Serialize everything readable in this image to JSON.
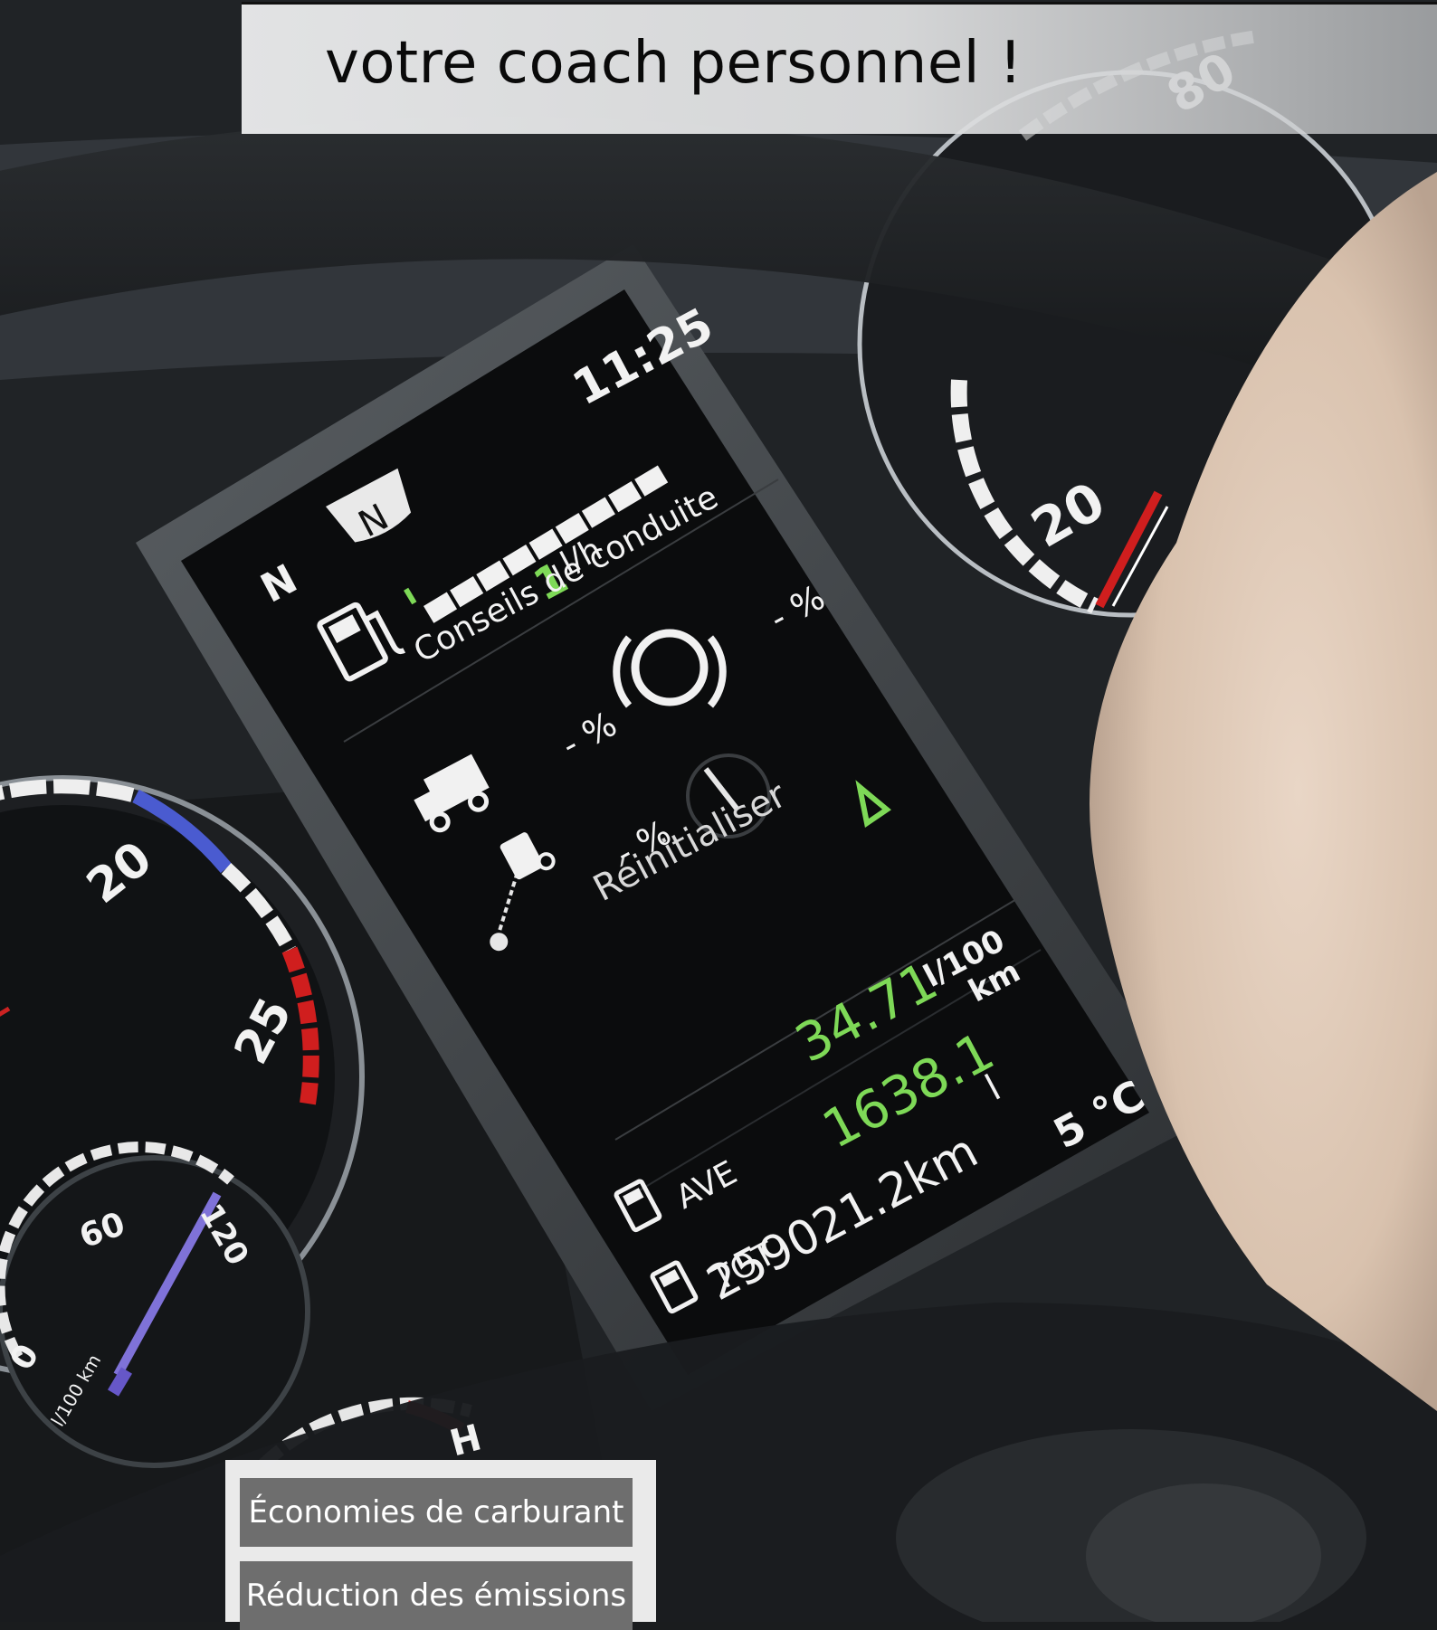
{
  "title": "votre coach personnel !",
  "tags": [
    "Économies de carburant",
    "Réduction des émissions"
  ],
  "display": {
    "time": "11:25",
    "gear_left": "N",
    "gear_badge": "N",
    "fuel_rate_value": "1",
    "fuel_rate_unit": "l/h",
    "section_title": "Conseils de conduite",
    "percent_1": "- %",
    "percent_2": "- %",
    "percent_3": "- %",
    "reset_label": "Réinitialiser",
    "avg_unit_top": "l/100",
    "avg_unit_bottom": "km",
    "avg_value": "34.71",
    "avg_label": "AVE",
    "tot_value": "1638.1",
    "tot_unit": "l",
    "tot_label": "TOT",
    "temperature": "5 °C",
    "odometer": "259021.2km"
  },
  "gauges": {
    "left_ticks": [
      "20",
      "25"
    ],
    "left_small_ticks": [
      "0",
      "60",
      "120"
    ],
    "left_small_unit": "l/100 km",
    "right_tick": "20",
    "top_right_tick": "80",
    "bottom_mark": "H"
  },
  "colors": {
    "lcd_green": "#7ed957",
    "gauge_red": "#d01e1e",
    "gauge_blue": "#4a5bd0",
    "banner_bg": "#e6e7e8",
    "tag_bg": "#6e6e6e"
  },
  "icons": [
    "fuel-pump-icon",
    "truck-icon",
    "brake-icon",
    "coasting-icon",
    "play-arrow-icon",
    "tachometer-icon"
  ]
}
